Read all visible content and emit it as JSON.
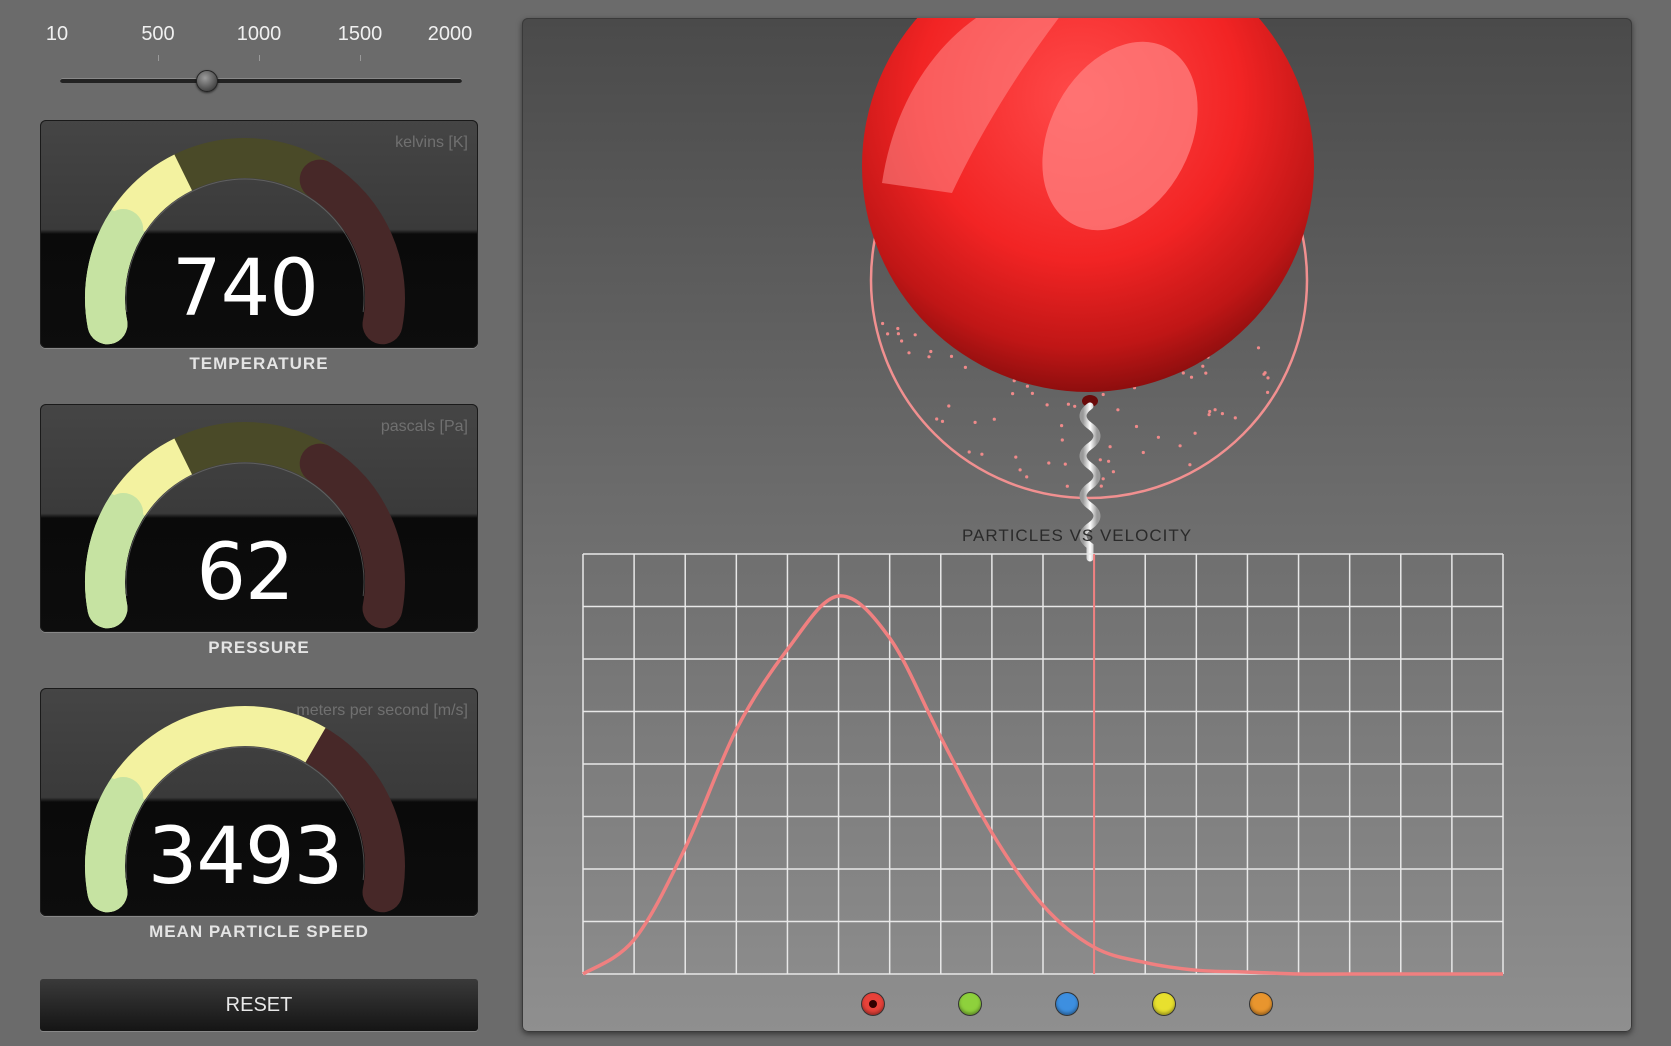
{
  "slider": {
    "ticks": [
      "10",
      "500",
      "1000",
      "1500",
      "2000"
    ],
    "min": 10,
    "max": 2000,
    "value": 740
  },
  "gauges": [
    {
      "id": "temperature",
      "unit": "kelvins [K]",
      "value": "740",
      "caption": "TEMPERATURE",
      "level": 0.37
    },
    {
      "id": "pressure",
      "unit": "pascals [Pa]",
      "value": "62",
      "caption": "PRESSURE",
      "level": 0.37
    },
    {
      "id": "speed",
      "unit": "meters per second [m/s]",
      "value": "3493",
      "caption": "MEAN PARTICLE SPEED",
      "level": 0.65
    }
  ],
  "reset": {
    "label": "RESET"
  },
  "simulation": {
    "chart_title": "PARTICLES VS VELOCITY",
    "balloon_color": "#ff2e2e",
    "curve_color": "#f08080",
    "particle_swatches": [
      {
        "name": "red",
        "color": "#e8423a",
        "selected": true
      },
      {
        "name": "green",
        "color": "#8ed13c",
        "selected": false
      },
      {
        "name": "blue",
        "color": "#3d8fe0",
        "selected": false
      },
      {
        "name": "yellow",
        "color": "#e8e02e",
        "selected": false
      },
      {
        "name": "orange",
        "color": "#e8952e",
        "selected": false
      }
    ]
  },
  "colors": {
    "gauge_green": "#c6e3a2",
    "gauge_yellow": "#f3f2a0",
    "gauge_olive": "#4a4a28",
    "gauge_maroon": "#472828"
  },
  "chart_data": {
    "type": "line",
    "title": "PARTICLES VS VELOCITY",
    "xlabel": "",
    "ylabel": "",
    "grid": true,
    "x": [
      0,
      1,
      2,
      3,
      4,
      5,
      6,
      7,
      8,
      9,
      10,
      11,
      12,
      13,
      14,
      15,
      16,
      17,
      18
    ],
    "series": [
      {
        "name": "",
        "values": [
          0,
          0.09,
          0.33,
          0.64,
          0.85,
          0.99,
          0.88,
          0.62,
          0.37,
          0.18,
          0.07,
          0.03,
          0.01,
          0.005,
          0,
          0,
          0,
          0,
          0
        ]
      }
    ],
    "marker_x": 10,
    "grid_cols": 18,
    "grid_rows": 8,
    "ylim": [
      0,
      1.1
    ]
  }
}
